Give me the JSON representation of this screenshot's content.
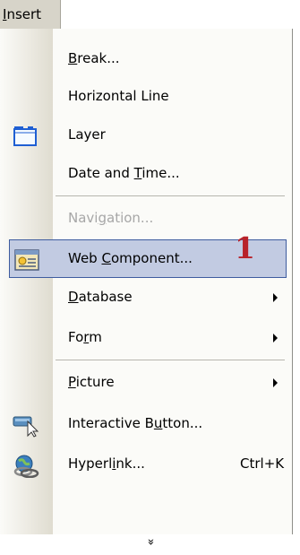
{
  "menubar": {
    "insert_label": "Insert"
  },
  "menu": {
    "items": [
      {
        "label_pre": "",
        "label_u": "B",
        "label_post": "reak...",
        "disabled": false
      },
      {
        "label_pre": "",
        "label_u": "",
        "label_post": "Horizontal Line",
        "disabled": false
      },
      {
        "label_pre": "",
        "label_u": "",
        "label_post": "Layer",
        "disabled": false,
        "icon": "layer-icon"
      },
      {
        "label_pre": "Date and ",
        "label_u": "T",
        "label_post": "ime...",
        "disabled": false
      },
      {
        "label_pre": "Navi",
        "label_u": "g",
        "label_post": "ation...",
        "disabled": true
      },
      {
        "label_pre": "Web ",
        "label_u": "C",
        "label_post": "omponent...",
        "disabled": false,
        "selected": true,
        "icon": "web-component-icon"
      },
      {
        "label_pre": "",
        "label_u": "D",
        "label_post": "atabase",
        "disabled": false,
        "submenu": true
      },
      {
        "label_pre": "Fo",
        "label_u": "r",
        "label_post": "m",
        "disabled": false,
        "submenu": true
      },
      {
        "label_pre": "",
        "label_u": "P",
        "label_post": "icture",
        "disabled": false,
        "submenu": true
      },
      {
        "label_pre": "Interactive B",
        "label_u": "u",
        "label_post": "tton...",
        "disabled": false,
        "icon": "interactive-button-icon"
      },
      {
        "label_pre": "Hyperl",
        "label_u": "i",
        "label_post": "nk...",
        "disabled": false,
        "icon": "hyperlink-icon",
        "shortcut": "Ctrl+K"
      }
    ],
    "annotation": "1",
    "expand_glyph": "»"
  }
}
